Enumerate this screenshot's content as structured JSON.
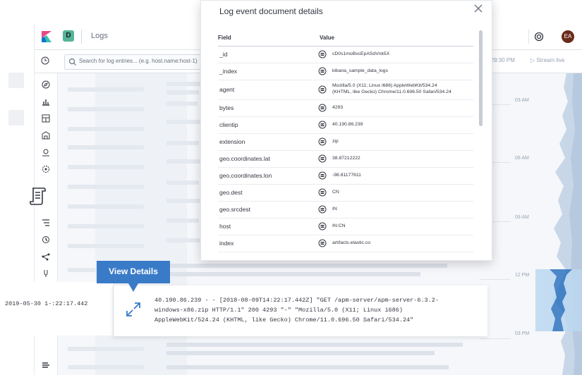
{
  "app": {
    "space_letter": "D",
    "title": "Logs",
    "avatar_initials": "EA"
  },
  "search": {
    "placeholder": "Search for log entries... (e.g. host.name:host-1)"
  },
  "time_control": {
    "time": "2:29:30 PM",
    "stream_label": "Stream live"
  },
  "minimap": {
    "time_labels": [
      "03 AM",
      "06 AM",
      "09 AM",
      "12 PM",
      "03 PM"
    ]
  },
  "modal": {
    "title": "Log event document details",
    "columns": {
      "field": "Field",
      "value": "Value"
    },
    "rows": [
      {
        "field": "_id",
        "value": "cD0s1moBvcEpASdVnk5X"
      },
      {
        "field": "_index",
        "value": "kibana_sample_data_logs"
      },
      {
        "field": "agent",
        "value": "Mozilla/5.0 (X11; Linux i686) AppleWebKit/534.24",
        "value2": "(KHTML, like Gecko) Chrome/11.0.696.50 Safari/534.24"
      },
      {
        "field": "bytes",
        "value": "4293"
      },
      {
        "field": "clientip",
        "value": "40.190.86.239"
      },
      {
        "field": "extension",
        "value": "zip"
      },
      {
        "field": "geo.coordinates.lat",
        "value": "38.87212222"
      },
      {
        "field": "geo.coordinates.lon",
        "value": "-98.81177611"
      },
      {
        "field": "geo.dest",
        "value": "CN"
      },
      {
        "field": "geo.srcdest",
        "value": "IN"
      },
      {
        "field": "host",
        "value": "IN:CN"
      },
      {
        "field": "index",
        "value": "artifacts.elastic.co"
      }
    ]
  },
  "tooltip": {
    "label": "View Details"
  },
  "log_entry": {
    "timestamp": "2019-05-30 1-:22:17.442",
    "line1": "40.190.86.239 - - [2018-08-09T14:22:17.442Z] \"GET /apm-server/apm-server-6.3.2-",
    "line2": "windows-x86.zip HTTP/1.1\" 200 4293 \"-\" \"Mozilla/5.0 (X11; Linux i686)",
    "line3": "AppleWebKit/524.24 (KHTML, like Gecko) Chrome/11.0.696.50 Safari/534.24\""
  },
  "colors": {
    "accent": "#3a7bc8",
    "minimap_highlight": "#bcd8f0",
    "space_badge": "#54b399",
    "avatar": "#6a2b1b"
  },
  "icons": [
    "kibana-logo-icon",
    "clock-icon",
    "search-icon",
    "play-icon",
    "help-icon",
    "close-icon",
    "filter-list-icon",
    "expand-icon",
    "logs-app-icon"
  ]
}
